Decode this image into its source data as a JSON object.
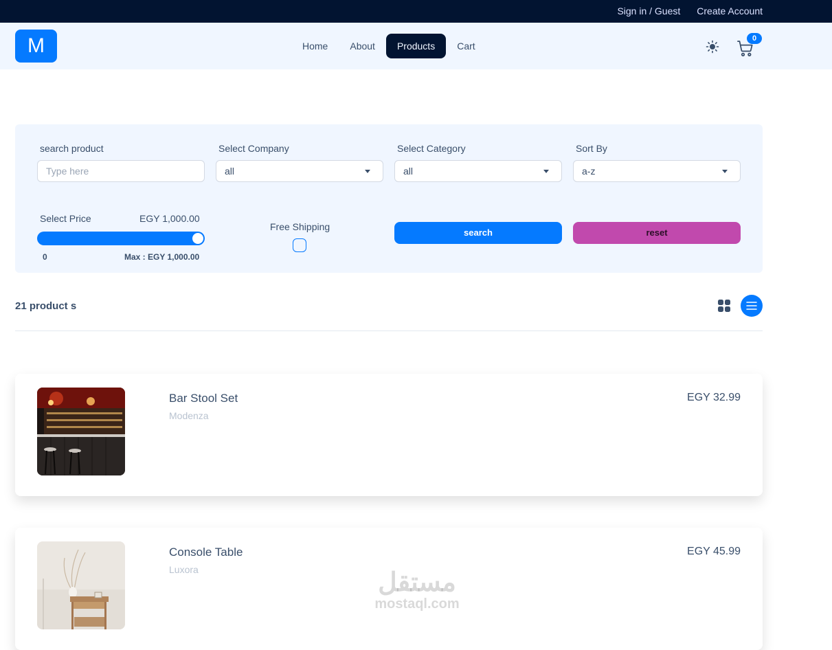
{
  "topbar": {
    "sign_in": "Sign in / Guest",
    "create_account": "Create Account"
  },
  "navbar": {
    "logo": "M",
    "links": [
      "Home",
      "About",
      "Products",
      "Cart"
    ],
    "active": "Products",
    "cart_count": "0",
    "theme_icon": "sun-icon",
    "cart_icon": "cart-icon"
  },
  "filters": {
    "search_label": "search product",
    "search_placeholder": "Type here",
    "company_label": "Select Company",
    "company_value": "all",
    "category_label": "Select Category",
    "category_value": "all",
    "sort_label": "Sort By",
    "sort_value": "a-z",
    "price_label": "Select Price",
    "price_value": "EGY 1,000.00",
    "price_fraction": 1.0,
    "price_min": "0",
    "price_max": "Max : EGY 1,000.00",
    "shipping_label": "Free Shipping",
    "shipping_checked": false,
    "search_button": "search",
    "reset_button": "reset"
  },
  "results": {
    "count_label": "21 product s",
    "grid_icon": "grid-icon",
    "list_icon": "list-icon"
  },
  "products": [
    {
      "title": "Bar Stool Set",
      "company": "Modenza",
      "price": "EGY 32.99"
    },
    {
      "title": "Console Table",
      "company": "Luxora",
      "price": "EGY 45.99"
    }
  ],
  "watermark": {
    "arabic": "مستقل",
    "latin": "mostaql.com"
  },
  "colors": {
    "primary": "#057aff",
    "secondary": "#c149ad",
    "dark": "#021431",
    "base": "#f0f6ff"
  }
}
